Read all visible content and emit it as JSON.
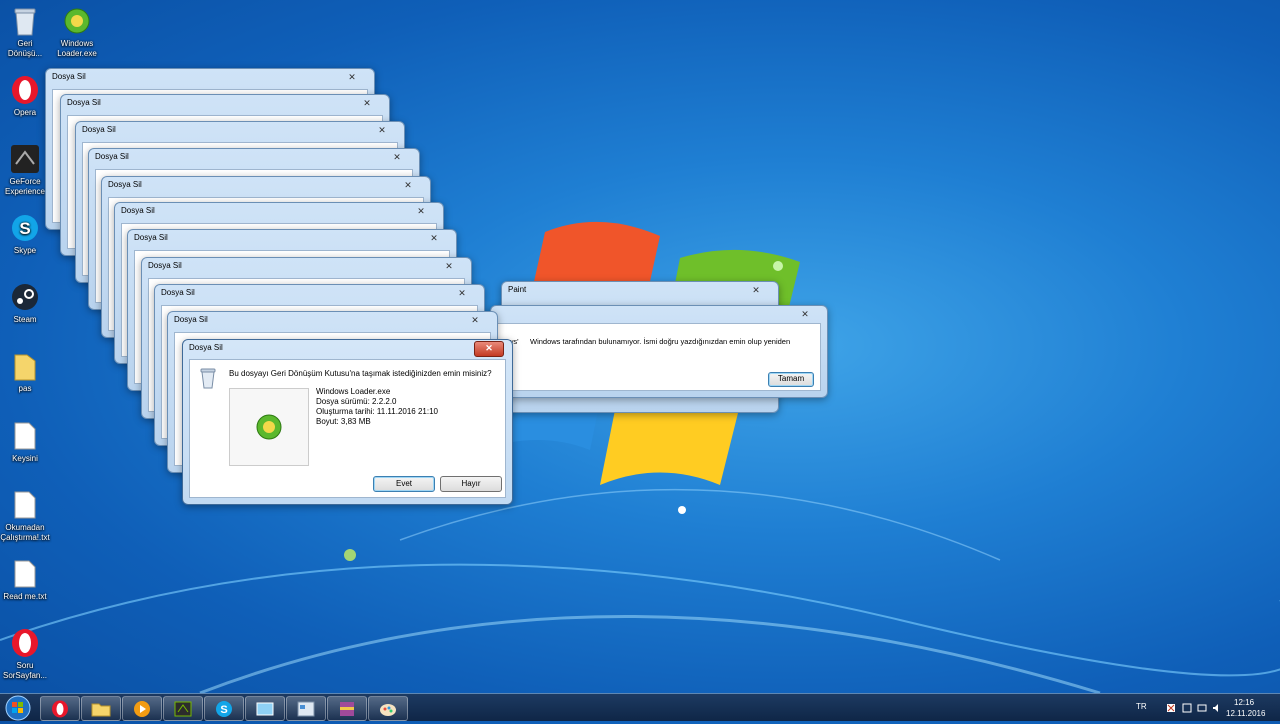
{
  "desktop_icons": [
    {
      "label": "Geri Dönüşü...",
      "icon": "recycle-bin-icon"
    },
    {
      "label": "Windows Loader.exe",
      "icon": "windows-loader-icon"
    },
    {
      "label": "Opera",
      "icon": "opera-icon"
    },
    {
      "label": "GeForce Experience",
      "icon": "geforce-icon"
    },
    {
      "label": "Skype",
      "icon": "skype-icon"
    },
    {
      "label": "Steam",
      "icon": "steam-icon"
    },
    {
      "label": "pas",
      "icon": "folder-icon"
    },
    {
      "label": "Keysini",
      "icon": "file-icon"
    },
    {
      "label": "Okumadan Çalıştırma!.txt",
      "icon": "text-file-icon"
    },
    {
      "label": "Read me.txt",
      "icon": "text-file-icon"
    },
    {
      "label": "Soru SorSayfan...",
      "icon": "opera-icon"
    }
  ],
  "stacked_dialog_title": "Dosya Sil",
  "close_glyph": "✕",
  "paint_window": {
    "title": "Paint"
  },
  "error_dialog": {
    "message": "Windows tarafından bulunamıyor. İsmi doğru yazdığınızdan emin olup yeniden",
    "message_prefix": "ws'",
    "ok_button": "Tamam"
  },
  "main_dialog": {
    "title": "Dosya Sil",
    "question": "Bu dosyayı Geri Dönüşüm Kutusu'na taşımak istediğinizden emin misiniz?",
    "file_name": "Windows Loader.exe",
    "file_version": "Dosya sürümü: 2.2.2.0",
    "created": "Oluşturma tarihi: 11.11.2016 21:10",
    "size": "Boyut: 3,83 MB",
    "yes_button": "Evet",
    "no_button": "Hayır"
  },
  "taskbar": {
    "pinned": [
      "opera-icon",
      "explorer-folder-icon",
      "media-player-icon",
      "nvidia-icon",
      "skype-icon",
      "aero-icon",
      "control-panel-icon",
      "winrar-icon",
      "paint-icon"
    ]
  },
  "tray": {
    "language": "TR",
    "time": "12:16",
    "date": "12.11.2016"
  },
  "colors": {
    "accent": "#2b7fd6",
    "close_red": "#c33a22"
  }
}
